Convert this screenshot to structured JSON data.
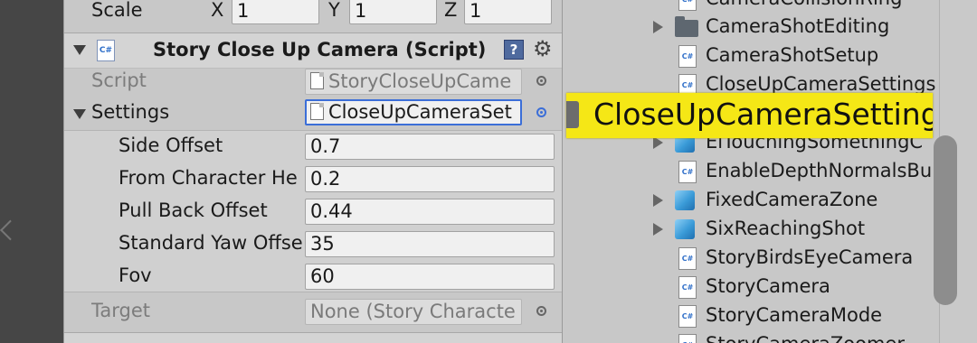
{
  "inspector": {
    "scale": {
      "label": "Scale",
      "x_label": "X",
      "x_value": "1",
      "y_label": "Y",
      "y_value": "1",
      "z_label": "Z",
      "z_value": "1"
    },
    "component": {
      "title": "Story Close Up Camera (Script)",
      "icon_text": "C#"
    },
    "script": {
      "label": "Script",
      "value": "StoryCloseUpCame"
    },
    "settings": {
      "label": "Settings",
      "value": "CloseUpCameraSet"
    },
    "fields": [
      {
        "label": "Side Offset",
        "value": "0.7"
      },
      {
        "label": "From Character He",
        "value": "0.2"
      },
      {
        "label": "Pull Back Offset",
        "value": "0.44"
      },
      {
        "label": "Standard Yaw Offse",
        "value": "35"
      },
      {
        "label": "Fov",
        "value": "60"
      }
    ],
    "target": {
      "label": "Target",
      "value": "None (Story Characte"
    }
  },
  "project": {
    "items": [
      {
        "label": "CameraCollisionRing",
        "icon": "script-icon"
      },
      {
        "label": "CameraShotEditing",
        "icon": "folder-icon"
      },
      {
        "label": "CameraShotSetup",
        "icon": "script-icon"
      },
      {
        "label": "CloseUpCameraSettings",
        "icon": "script-icon"
      },
      {
        "label": "ElTouchingSomethingC",
        "icon": "cube-icon"
      },
      {
        "label": "EnableDepthNormalsBu",
        "icon": "script-icon"
      },
      {
        "label": "FixedCameraZone",
        "icon": "cube-icon"
      },
      {
        "label": "SixReachingShot",
        "icon": "cube-icon"
      },
      {
        "label": "StoryBirdsEyeCamera",
        "icon": "script-icon"
      },
      {
        "label": "StoryCamera",
        "icon": "script-icon"
      },
      {
        "label": "StoryCameraMode",
        "icon": "script-icon"
      },
      {
        "label": "StoryCameraZoomer",
        "icon": "script-icon"
      }
    ]
  },
  "drag_tooltip": {
    "text": "CloseUpCameraSettings"
  }
}
